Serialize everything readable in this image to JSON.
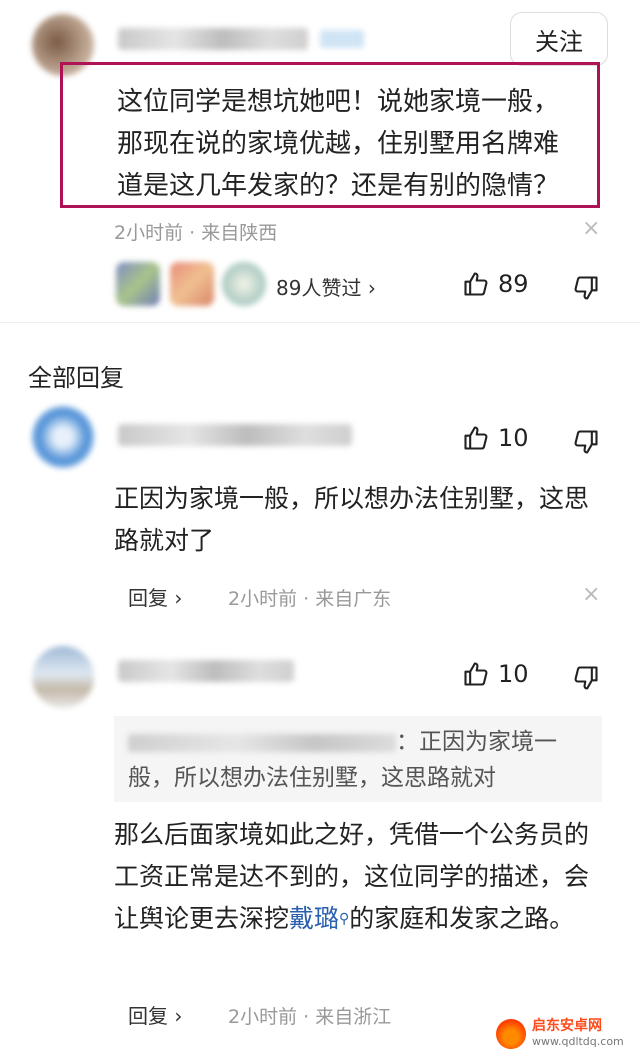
{
  "top_comment": {
    "follow_label": "关注",
    "text": "这位同学是想坑她吧！说她家境一般，那现在说的家境优越，住别墅用名牌难道是这几年发家的？还是有别的隐情？",
    "time": "2小时前",
    "location_sep": "·",
    "location": "来自陕西",
    "likes_summary": "89人赞过",
    "likes_arrow": "›",
    "like_count": "89",
    "close": "×"
  },
  "section": {
    "title": "全部回复"
  },
  "replies": [
    {
      "like_count": "10",
      "text": "正因为家境一般，所以想办法住别墅，这思路就对了",
      "reply_label": "回复 ›",
      "time": "2小时前",
      "location_sep": "·",
      "location": "来自广东",
      "close": "×"
    },
    {
      "like_count": "10",
      "quote_text": "：正因为家境一般，所以想办法住别墅，这思路就对",
      "text_part1": "那么后面家境如此之好，凭借一个公务员的工资正常是达不到的，这位同学的描述，会让舆论更去深挖",
      "text_link": "戴璐",
      "text_part2": "的家庭和发家之路。",
      "reply_label": "回复 ›",
      "time": "2小时前",
      "location_sep": "·",
      "location": "来自浙江"
    }
  ],
  "watermark": {
    "cn": "启东安卓网",
    "url": "www.qdltdq.com"
  },
  "colors": {
    "highlight_border": "#b01355",
    "link": "#2a5fad",
    "meta": "#999999"
  }
}
